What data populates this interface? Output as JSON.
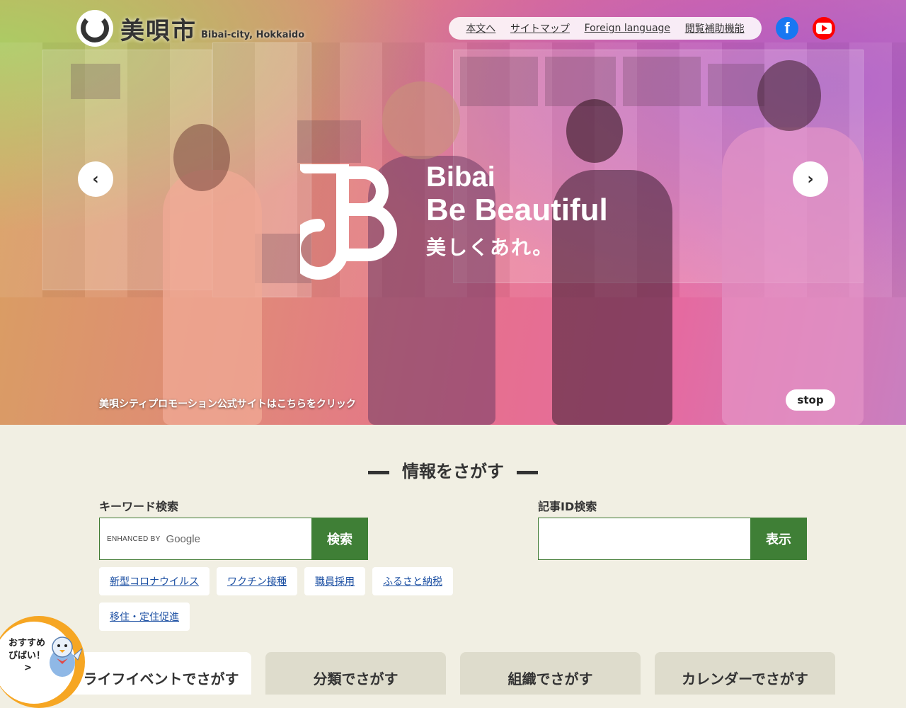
{
  "header": {
    "logo_name": "美唄市",
    "logo_sub": "Bibai-city, Hokkaido",
    "util_nav": [
      "本文へ",
      "サイトマップ",
      "Foreign language",
      "閲覧補助機能"
    ],
    "sns": {
      "facebook": "f"
    }
  },
  "hero": {
    "brand_line1": "Bibai",
    "brand_line2": "Be Beautiful",
    "brand_line3": "美しくあれ。",
    "prev": "‹",
    "next": "›",
    "promo_text": "美唄シティプロモーション公式サイトはこちらをクリック",
    "stop_label": "stop"
  },
  "search": {
    "title": "情報をさがす",
    "keyword_label": "キーワード検索",
    "keyword_enhanced": "ENHANCED BY",
    "keyword_google": "Google",
    "keyword_button": "検索",
    "id_label": "記事ID検索",
    "id_button": "表示",
    "tags": [
      "新型コロナウイルス",
      "ワクチン接種",
      "職員採用",
      "ふるさと納税",
      "移住・定住促進"
    ]
  },
  "mascot": {
    "text_line1": "おすすめ",
    "text_line2": "びばい！",
    "arrow": ">"
  },
  "nav_cards": [
    "ライフイベントでさがす",
    "分類でさがす",
    "組織でさがす",
    "カレンダーでさがす"
  ],
  "colors": {
    "accent_green": "#3f7f36",
    "page_bg": "#f1efe3",
    "link_blue": "#1a4ea2"
  }
}
